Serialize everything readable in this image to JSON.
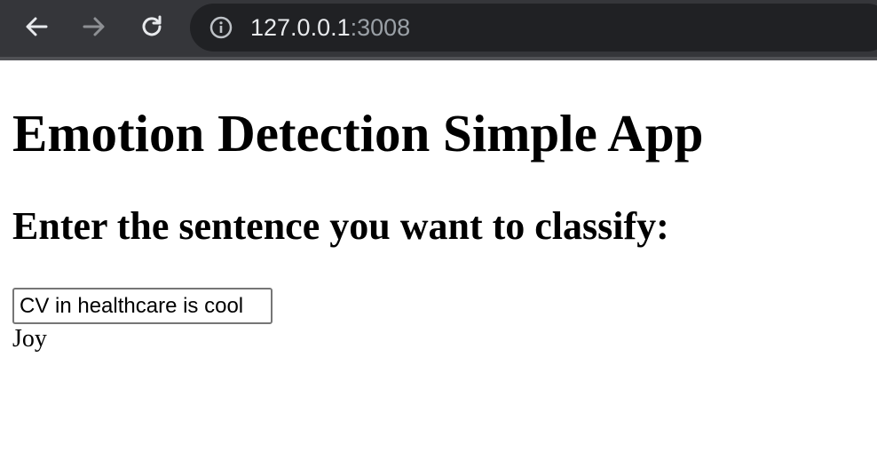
{
  "browser": {
    "url_host": "127.0.0.1",
    "url_port": ":3008"
  },
  "page": {
    "title": "Emotion Detection Simple App",
    "subtitle": "Enter the sentence you want to classify:",
    "input_value": "CV in healthcare is cool",
    "result": "Joy"
  },
  "icons": {
    "back": "arrow-left-icon",
    "forward": "arrow-right-icon",
    "reload": "reload-icon",
    "info": "info-icon"
  },
  "colors": {
    "toolbar": "#35363a",
    "omnibox": "#202124",
    "url_text": "#e8eaed",
    "url_port": "#9aa0a6"
  }
}
